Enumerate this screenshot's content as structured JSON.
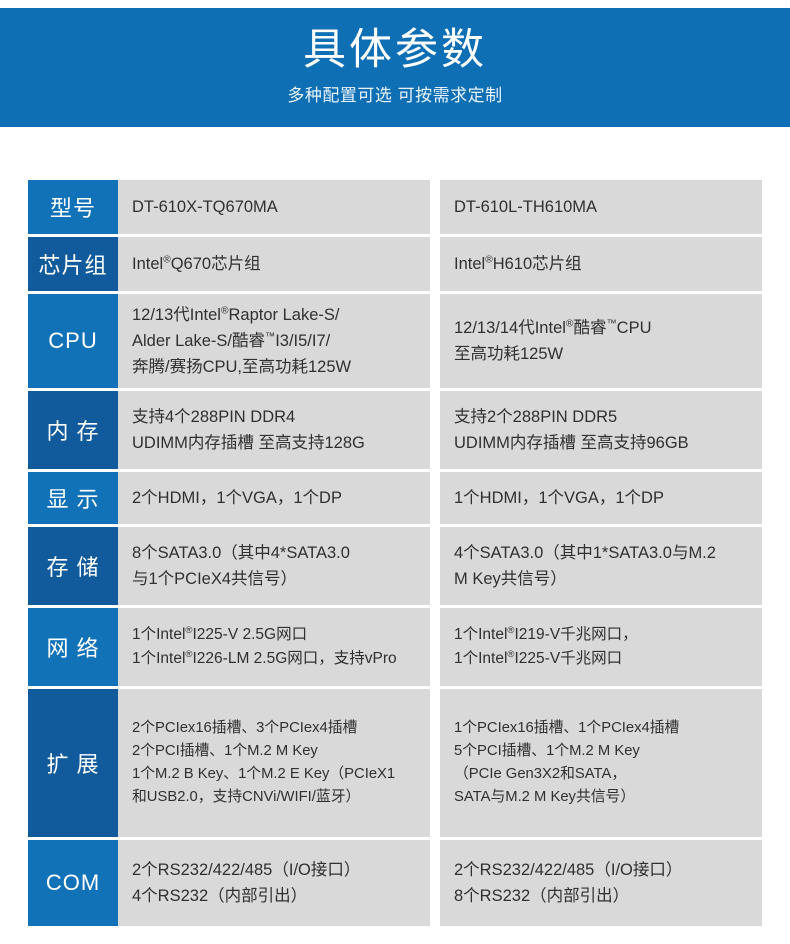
{
  "banner": {
    "title": "具体参数",
    "subtitle": "多种配置可选 可按需求定制",
    "background_color": "#0f6fb5",
    "title_color": "#ffffff"
  },
  "colors": {
    "label_blue": "#1272b8",
    "label_blue_alt": "#115b9c",
    "value_gray": "#d9d9d9",
    "value_text": "#303030",
    "page_background": "#ffffff"
  },
  "table": {
    "columns": [
      "DT-610X-TQ670MA",
      "DT-610L-TH610MA"
    ],
    "rows": [
      {
        "label": "型号",
        "col_a": [
          "DT-610X-TQ670MA"
        ],
        "col_b": [
          "DT-610L-TH610MA"
        ]
      },
      {
        "label": "芯片组",
        "col_a": [
          "Intel®Q670芯片组"
        ],
        "col_b": [
          "Intel®H610芯片组"
        ]
      },
      {
        "label": "CPU",
        "col_a": [
          "12/13代Intel®Raptor Lake-S/",
          "Alder Lake-S/酷睿™I3/I5/I7/",
          "奔腾/赛扬CPU,至高功耗125W"
        ],
        "col_b": [
          " 12/13/14代Intel®酷睿™CPU",
          "至高功耗125W"
        ]
      },
      {
        "label": "内 存",
        "col_a": [
          "支持4个288PIN DDR4",
          "UDIMM内存插槽 至高支持128G"
        ],
        "col_b": [
          "支持2个288PIN DDR5",
          "UDIMM内存插槽 至高支持96GB"
        ]
      },
      {
        "label": "显 示",
        "col_a": [
          "2个HDMI，1个VGA，1个DP"
        ],
        "col_b": [
          "1个HDMI，1个VGA，1个DP"
        ]
      },
      {
        "label": "存 储",
        "col_a": [
          "8个SATA3.0（其中4*SATA3.0",
          "与1个PCIeX4共信号）"
        ],
        "col_b": [
          "4个SATA3.0（其中1*SATA3.0与M.2",
          "M Key共信号）"
        ]
      },
      {
        "label": "网 络",
        "col_a": [
          "1个Intel®I225-V 2.5G网口",
          "1个Intel®I226-LM 2.5G网口，支持vPro"
        ],
        "col_b": [
          "1个Intel®I219-V千兆网口，",
          "1个Intel®I225-V千兆网口"
        ]
      },
      {
        "label": "扩 展",
        "col_a": [
          "2个PCIex16插槽、3个PCIex4插槽",
          "2个PCI插槽、1个M.2 M Key",
          "1个M.2 B Key、1个M.2 E Key（PCIeX1",
          "和USB2.0，支持CNVi/WIFI/蓝牙）"
        ],
        "col_b": [
          "1个PCIex16插槽、1个PCIex4插槽",
          "5个PCI插槽、1个M.2 M Key",
          "（PCIe Gen3X2和SATA，",
          "SATA与M.2 M Key共信号）"
        ]
      },
      {
        "label": "COM",
        "col_a": [
          "2个RS232/422/485（I/O接口）",
          "4个RS232（内部引出）"
        ],
        "col_b": [
          "2个RS232/422/485（I/O接口）",
          "8个RS232（内部引出）"
        ]
      }
    ]
  }
}
